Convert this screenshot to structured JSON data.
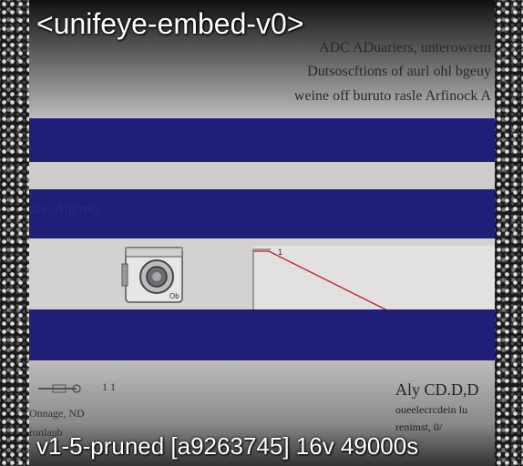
{
  "overlay": {
    "top_label": "<unifeye-embed-v0>",
    "bottom_label": "v1-5-pruned [a9263745]  16v 49000s"
  },
  "header": {
    "line1": "ADC ADuariers, unterowrem",
    "line2": "Dutsoscftions of aurl ohl bgeuy",
    "line3": "weine off buruto rasle Arfinock A"
  },
  "section": {
    "label": "uho Afgiruly"
  },
  "bottom_left": {
    "icon_caption": "1 1",
    "line1": "Onnage, ND",
    "line2": "ronlaub"
  },
  "bottom_right": {
    "title": "Aly CD.D,D",
    "line1": "oueelecrcdein lu",
    "line2": "renimst, 0/"
  },
  "colors": {
    "band": "#201f78",
    "chart_line_primary": "#c02020",
    "chart_line_secondary": "#b06040"
  },
  "icons": {
    "appliance": "washing-machine-icon",
    "small_tool": "wrench-icon"
  }
}
